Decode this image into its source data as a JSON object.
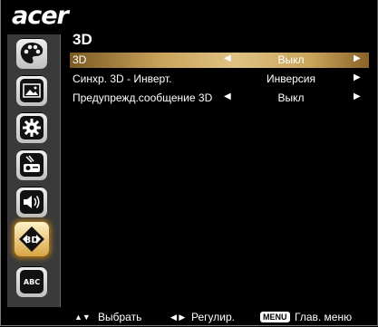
{
  "brand": {
    "logo_text": "acer"
  },
  "sidebar": {
    "items": [
      {
        "name": "color-icon",
        "active": false
      },
      {
        "name": "image-icon",
        "active": false
      },
      {
        "name": "settings-icon",
        "active": false
      },
      {
        "name": "projector-icon",
        "active": false
      },
      {
        "name": "speaker-icon",
        "active": false
      },
      {
        "name": "3d-icon",
        "active": true
      },
      {
        "name": "language-icon",
        "active": false,
        "text": "ABC"
      }
    ]
  },
  "panel": {
    "title": "3D",
    "rows": [
      {
        "label": "3D",
        "value": "Выкл",
        "selected": true
      },
      {
        "label": "Синхр. 3D - Инверт.",
        "value": "Инверсия",
        "selected": false
      },
      {
        "label": "Предупрежд.сообщение 3D",
        "value": "Выкл",
        "selected": false
      }
    ],
    "left_arrow": "◀",
    "right_arrow": "▶"
  },
  "footer": {
    "select_icon": "▲▼",
    "select_label": "Выбрать",
    "adjust_icon": "◀ ▶",
    "adjust_label": "Регулир.",
    "menu_key": "MENU",
    "menu_label": "Глав. меню"
  },
  "colors": {
    "selected_row": "#c8a25a",
    "active_icon": "#d7a441",
    "sidebar_bg": "#3a3a3a"
  }
}
